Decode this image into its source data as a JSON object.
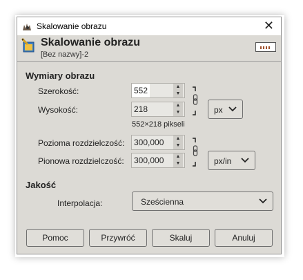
{
  "window": {
    "title": "Skalowanie obrazu",
    "close_glyph": "✕"
  },
  "header": {
    "title": "Skalowanie obrazu",
    "subtitle": "[Bez nazwy]-2"
  },
  "image_size": {
    "section_label": "Wymiary obrazu",
    "width_label": "Szerokość:",
    "width_value": "552",
    "height_label": "Wysokość:",
    "height_value": "218",
    "unit": "px",
    "pixel_info": "552×218 pikseli",
    "xres_label": "Pozioma rozdzielczość:",
    "xres_value": "300,000",
    "yres_label": "Pionowa rozdzielczość:",
    "yres_value": "300,000",
    "res_unit": "px/in"
  },
  "quality": {
    "section_label": "Jakość",
    "interp_label": "Interpolacja:",
    "interp_value": "Sześcienna"
  },
  "buttons": {
    "help": "Pomoc",
    "reset": "Przywróć",
    "scale": "Skaluj",
    "cancel": "Anuluj"
  }
}
